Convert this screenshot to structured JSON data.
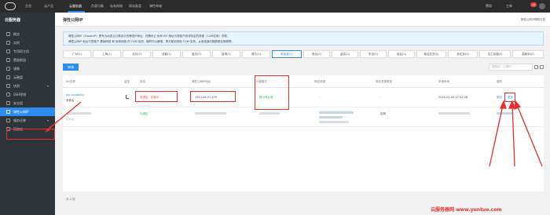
{
  "topbar": {
    "nav": [
      "总览",
      "云产品",
      "云服务器",
      "负载均衡",
      "私有网络",
      "网站备案",
      "弹性伸缩"
    ],
    "active_index": 2,
    "right": [
      "费用",
      "工单"
    ],
    "badge": "10"
  },
  "sidebar": {
    "title": "云服务器",
    "items": [
      {
        "label": "概览"
      },
      {
        "label": "实例"
      },
      {
        "label": "专用宿主机"
      },
      {
        "label": "置放群组"
      },
      {
        "label": "镜像"
      },
      {
        "label": "云硬盘"
      },
      {
        "label": "快照",
        "caret": "▾"
      },
      {
        "label": "SSH密钥"
      },
      {
        "label": "安全组"
      },
      {
        "label": "弹性公网IP"
      },
      {
        "label": "服务迁移",
        "caret": "▾"
      },
      {
        "label": "回收站",
        "caret": "▾"
      }
    ],
    "active_index": 9
  },
  "header": {
    "title": "弹性公网IP",
    "help": "弹性公网IP帮助文档"
  },
  "notice": {
    "line1": "弹性公网IP（ElasticIP）是专为动态云计算设计的静态IP地址。在腾讯云 私有 EIP 地址与您账户而非特定的资源（CVM实例）关联。",
    "line2": "弹性公网IP 地址与您账户 基础网络 和 私有网络 的 CVM 实例，随时可以解绑，再分配到其他 CVM 实例。从而快速切换屏蔽实例故障。"
  },
  "regions": [
    "广州(1)",
    "上海(1)",
    "北京(3)",
    "成都(1)",
    "重庆(0)",
    "香港(1)",
    "首尔(2)",
    "新加坡(0)",
    "曼谷(0)",
    "孟买(0)",
    "东京(0)",
    "硅谷(0)",
    "弗吉尼亚(0)",
    "多伦多(0)",
    "法兰克福(0)",
    "莫斯科(0)"
  ],
  "regions_active_index": 7,
  "toolbar": {
    "apply_label": "申请",
    "search_placeholder": "搜索ID，公网IP..."
  },
  "table": {
    "headers": [
      "ID/名称",
      "监控",
      "状态",
      "弹性公网IP地址",
      "计费模式",
      "绑定资源",
      "绑定资源类型",
      "申请时间",
      "操作"
    ],
    "rows": [
      {
        "id": "eip-xcawb0zj",
        "name": "未命名",
        "status": "未绑定，扣费中",
        "ip": "150.109.97.109",
        "billing": "按小时计费",
        "resource": "-",
        "resource_type": "-",
        "time": "2019-01-04 17:03:28",
        "op1": "绑定",
        "op2": "更多"
      },
      {
        "id": "",
        "name": "未命名",
        "status": "已绑定",
        "ip": "",
        "billing": "",
        "resource": "",
        "resource_type": "实例",
        "time": "",
        "op1": "",
        "op2": ""
      }
    ]
  },
  "footer": {
    "total": "共 2 项"
  },
  "watermark": "云服务器网 www.yuntue.com",
  "colors": {
    "accent": "#2d8cf0",
    "annotation": "#e53030",
    "sidebar_bg": "#2f343b",
    "topbar_bg": "#2b2b2b"
  }
}
